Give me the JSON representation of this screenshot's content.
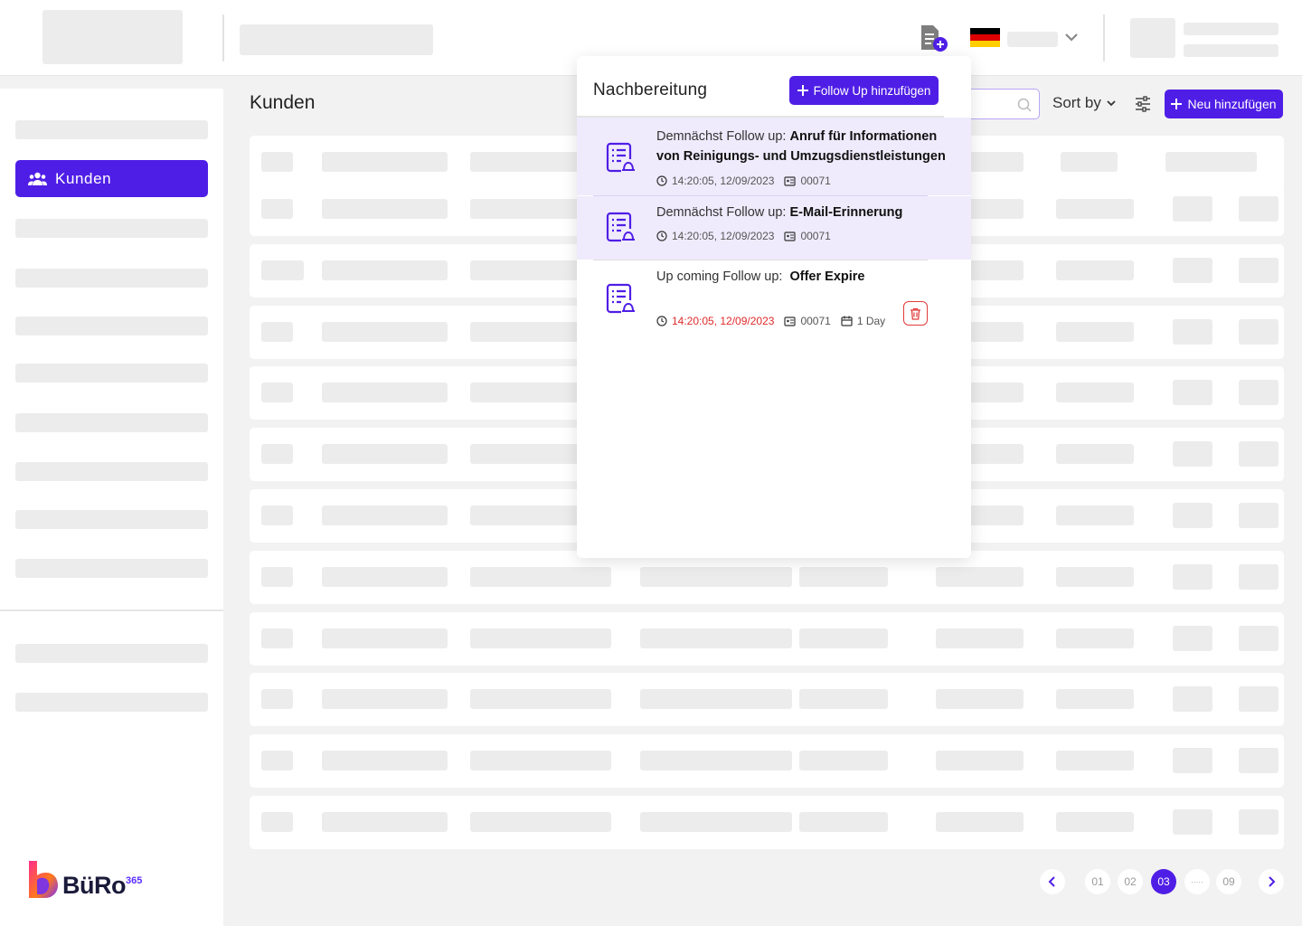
{
  "sidebar": {
    "active_item": "Kunden",
    "logo": {
      "brand": "BüRo",
      "sup": "365"
    }
  },
  "header": {
    "language_flag": "germany-flag-icon",
    "add_document_icon": "document-add-icon"
  },
  "main": {
    "title": "Kunden",
    "search_placeholder": "",
    "sort_label": "Sort by",
    "add_button": "Neu hinzufügen"
  },
  "popup": {
    "title": "Nachbereitung",
    "add_button": "Follow Up hinzufügen",
    "items": [
      {
        "prefix": "Demnächst Follow up:",
        "title": "Anruf für Informationen von Reinigungs- und Umzugsdienstleistungen",
        "time": "14:20:05, 12/09/2023",
        "id": "00071"
      },
      {
        "prefix": "Demnächst Follow up:",
        "title": "E-Mail-Erinnerung",
        "time": "14:20:05, 12/09/2023",
        "id": "00071"
      },
      {
        "prefix": "Up coming Follow up:",
        "title": "Offer Expire",
        "time": "14:20:05, 12/09/2023",
        "id": "00071",
        "duration": "1 Day"
      }
    ]
  },
  "pagination": {
    "pages": [
      "01",
      "02",
      "03",
      "·····",
      "09"
    ],
    "active": "03"
  },
  "colors": {
    "accent": "#4f1ee6",
    "danger": "#e02a2a",
    "highlight": "#efebfc"
  }
}
